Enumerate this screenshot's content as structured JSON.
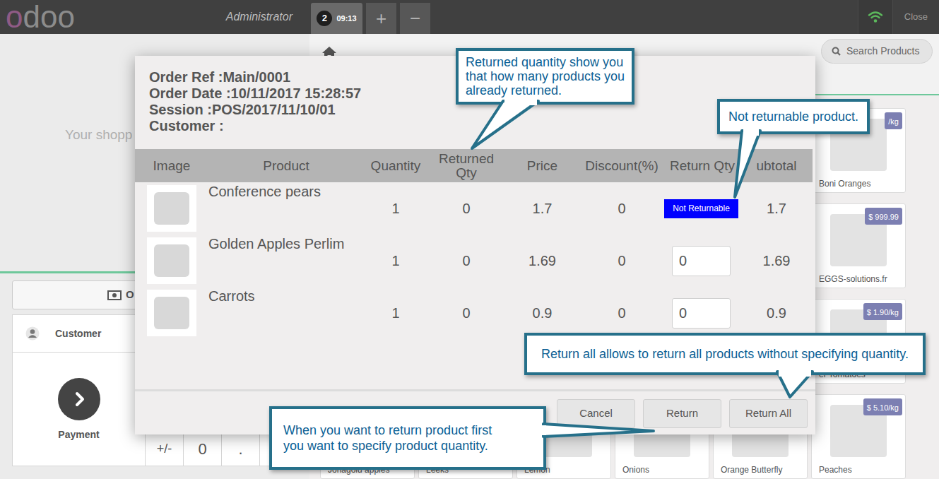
{
  "header": {
    "logo": [
      "o",
      "doo"
    ],
    "user": "Administrator",
    "orders": [
      {
        "number": "2",
        "time": "09:13",
        "selected": true
      }
    ],
    "add_order": "+",
    "remove_order": "−",
    "connection": {
      "online": true
    },
    "close": "Close"
  },
  "order_panel": {
    "empty_message": "Your shopp",
    "order_button": "O",
    "customer": "Customer",
    "payment": "Payment",
    "numpad": [
      "+/-",
      "0",
      "."
    ]
  },
  "product_bar": {
    "search_placeholder": "Search Products"
  },
  "products": {
    "side_column": [
      {
        "name": "Boni Oranges",
        "price": "/kg"
      },
      {
        "name": "EGGS-solutions.fr",
        "price": "$ 999.99"
      },
      {
        "name": "er Tomatoes",
        "price": "$ 1.90/kg"
      }
    ],
    "bottom_row": [
      {
        "name": "Jonagold apples"
      },
      {
        "name": "Leeks"
      },
      {
        "name": "Lemon"
      },
      {
        "name": "Onions"
      },
      {
        "name": "Orange Butterfly"
      },
      {
        "name": "Peaches",
        "price": "$ 5.10/kg"
      }
    ]
  },
  "dialog": {
    "order_ref": "Order Ref :Main/0001",
    "order_date": "Order Date :10/11/2017 15:28:57",
    "session": "Session :POS/2017/11/10/01",
    "customer": "Customer :",
    "columns": [
      "Image",
      "Product",
      "Quantity",
      "Returned Qty",
      "Price",
      "Discount(%)",
      "Return Qty",
      "ubtotal"
    ],
    "rows": [
      {
        "product": "Conference pears",
        "quantity": "1",
        "returned": "0",
        "price": "1.7",
        "discount": "0",
        "kind": "badge",
        "return_qty": "Not Returnable",
        "subtotal": "1.7"
      },
      {
        "product": "Golden Apples Perlim",
        "quantity": "1",
        "returned": "0",
        "price": "1.69",
        "discount": "0",
        "kind": "input",
        "return_qty": "0",
        "subtotal": "1.69"
      },
      {
        "product": "Carrots",
        "quantity": "1",
        "returned": "0",
        "price": "0.9",
        "discount": "0",
        "kind": "input",
        "return_qty": "0",
        "subtotal": "0.9"
      }
    ],
    "buttons": [
      "Cancel",
      "Return",
      "Return All"
    ]
  },
  "callouts": [
    {
      "lines": [
        "Returned quantity show you",
        "that how many products you",
        "already returned."
      ]
    },
    {
      "lines": [
        "Not returnable product."
      ]
    },
    {
      "lines": [
        "Return all allows to return all products without specifying quantity."
      ]
    },
    {
      "lines": [
        "When you want to return product first",
        "you want to specify product quantity."
      ]
    }
  ]
}
